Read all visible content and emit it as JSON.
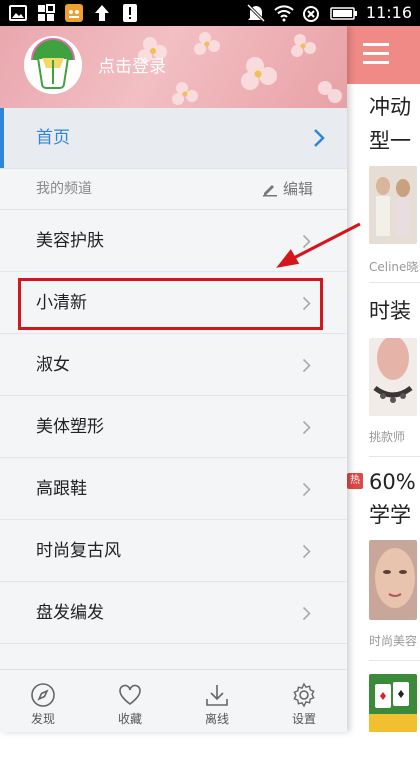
{
  "status_bar": {
    "time": "11:16",
    "left_icons": [
      "image-icon",
      "grid-icon",
      "game-icon",
      "upload-icon",
      "alert-icon"
    ],
    "right_icons": [
      "mute-icon",
      "wifi-icon",
      "signal-icon",
      "battery-icon"
    ]
  },
  "drawer": {
    "login_text": "点击登录",
    "home_label": "首页",
    "section_label": "我的频道",
    "edit_label": "编辑",
    "channels": [
      {
        "label": "美容护肤"
      },
      {
        "label": "小清新"
      },
      {
        "label": "淑女"
      },
      {
        "label": "美体塑形"
      },
      {
        "label": "高跟鞋"
      },
      {
        "label": "时尚复古风"
      },
      {
        "label": "盘发编发"
      }
    ],
    "nav": [
      {
        "label": "发现",
        "icon": "compass-icon"
      },
      {
        "label": "收藏",
        "icon": "heart-icon"
      },
      {
        "label": "离线",
        "icon": "download-icon"
      },
      {
        "label": "设置",
        "icon": "gear-icon"
      }
    ]
  },
  "feed": {
    "articles": [
      {
        "title_line1": "冲动",
        "title_line2": "型一",
        "source": "Celine晓"
      },
      {
        "title_line1": "时装",
        "source": "挑款师"
      },
      {
        "title_line1": "60%",
        "title_line2": "学学",
        "source": "时尚美容",
        "badge": "热"
      }
    ]
  },
  "colors": {
    "accent": "#2f86d8",
    "header_pink": "#f08a86",
    "highlight_red": "#d4151c"
  }
}
